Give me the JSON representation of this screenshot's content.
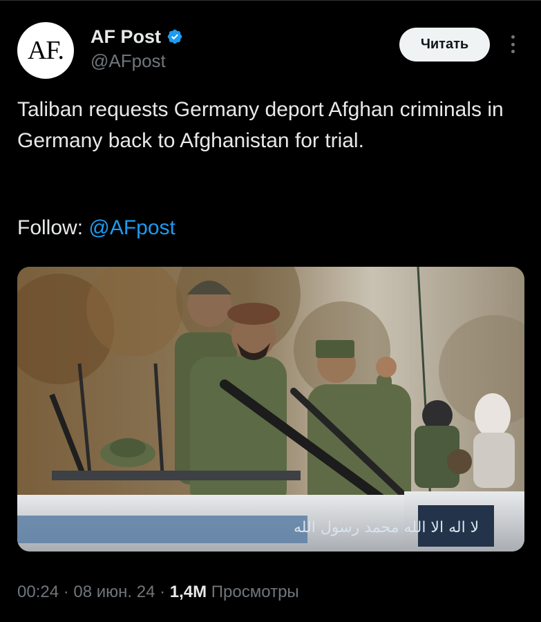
{
  "author": {
    "avatar_text": "AF.",
    "name": "AF Post",
    "handle": "@AFpost",
    "verified": true
  },
  "follow_button_label": "Читать",
  "more_icon": "more-vertical-icon",
  "tweet": {
    "text": "Taliban requests Germany deport Afghan criminals in Germany back to Afghanistan for trial.",
    "follow_prefix": "Follow: ",
    "follow_mention": "@AFpost"
  },
  "media": {
    "icon": "photo-image",
    "vehicle_text": "لا اله الا الله محمد رسول الله"
  },
  "meta": {
    "time": "00:24",
    "separator": " · ",
    "date": "08 июн. 24",
    "views_count": "1,4M",
    "views_label": " Просмотры"
  },
  "colors": {
    "background": "#000000",
    "text": "#e7e9ea",
    "secondary": "#71767b",
    "link": "#1d9bf0",
    "verified": "#1d9bf0",
    "button_bg": "#eff3f4"
  }
}
